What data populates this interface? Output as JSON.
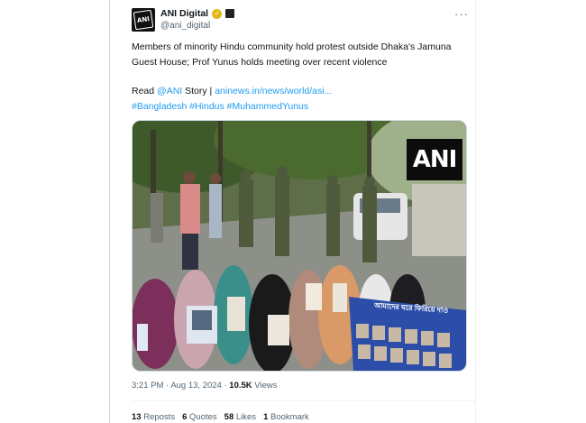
{
  "account": {
    "name": "ANI Digital",
    "handle": "@ani_digital",
    "avatar_text": "ANI",
    "verified_color": "#e2b719",
    "more_label": "···"
  },
  "tweet": {
    "body": "Members of minority Hindu community hold protest outside Dhaka's Jamuna Guest House; Prof Yunus holds meeting over recent violence",
    "read_prefix": "Read ",
    "read_mention": "@ANI",
    "read_mid": " Story | ",
    "link": "aninews.in/news/world/asi...",
    "hashtags": "#Bangladesh #Hindus #MuhammedYunus",
    "link_color": "#1d9bf0"
  },
  "media": {
    "watermark": "ANI",
    "banner_text": "আমাদের ঘরে ফিরিয়ে দাও"
  },
  "meta": {
    "time": "3:21 PM",
    "sep1": " · ",
    "date": "Aug 13, 2024",
    "sep2": " · ",
    "views_count": "10.5K",
    "views_label": " Views"
  },
  "stats": {
    "reposts_count": "13",
    "reposts_label": " Reposts",
    "quotes_count": "6",
    "quotes_label": " Quotes",
    "likes_count": "58",
    "likes_label": " Likes",
    "bookmarks_count": "1",
    "bookmarks_label": " Bookmark"
  }
}
